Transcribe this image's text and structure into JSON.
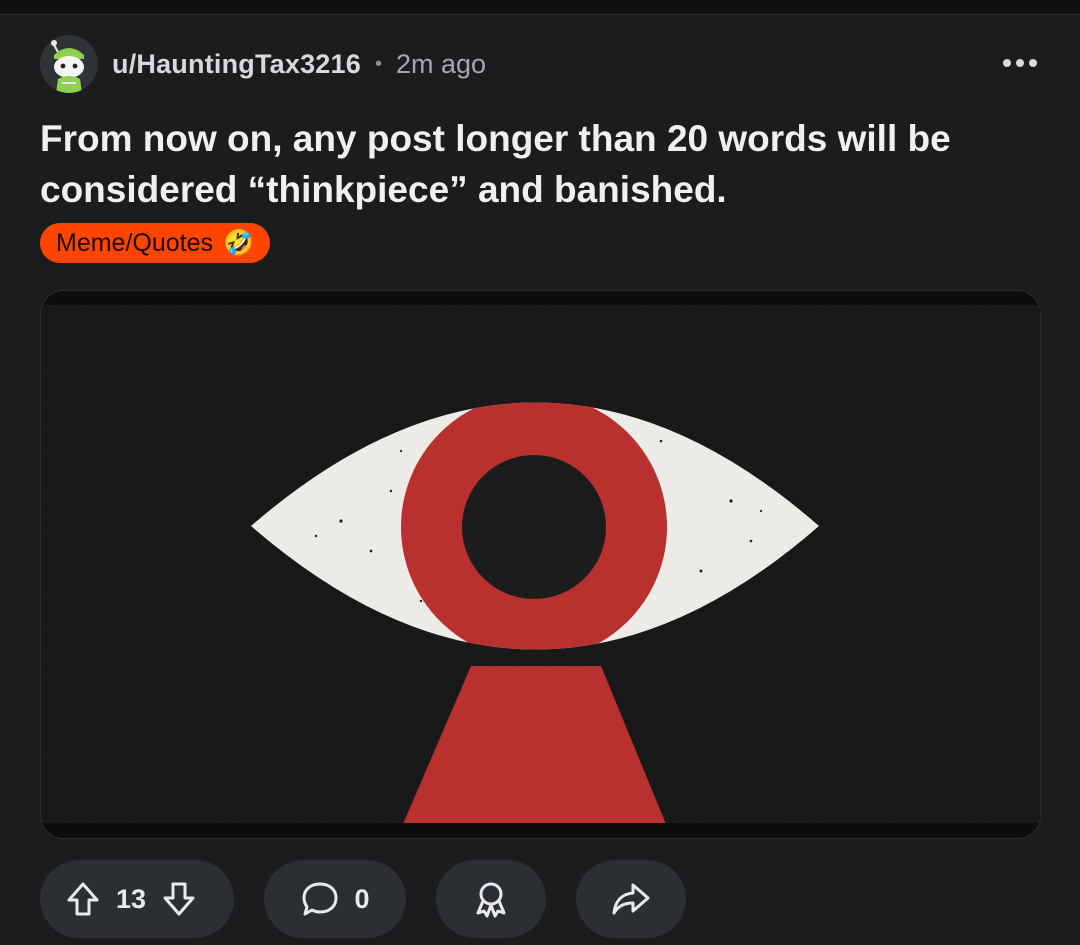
{
  "post": {
    "author": "u/HauntingTax3216",
    "separator": "•",
    "age": "2m ago",
    "title": "From now on, any post longer than 20 words will be considered “thinkpiece” and banished.",
    "flair": {
      "label": "Meme/Quotes",
      "emoji": "🤣",
      "color": "#ff4500"
    },
    "image": {
      "subject": "stylized red iris eye with keyhole on black textured background"
    }
  },
  "actions": {
    "score": "13",
    "comments": "0"
  },
  "icons": {
    "more": "more-horizontal-icon",
    "upvote": "arrow-up-icon",
    "downvote": "arrow-down-icon",
    "comment": "comment-bubble-icon",
    "award": "award-icon",
    "share": "share-arrow-icon"
  },
  "colors": {
    "background": "#1a1c1e",
    "pill": "#2b2f33",
    "accent": "#ff4500"
  }
}
